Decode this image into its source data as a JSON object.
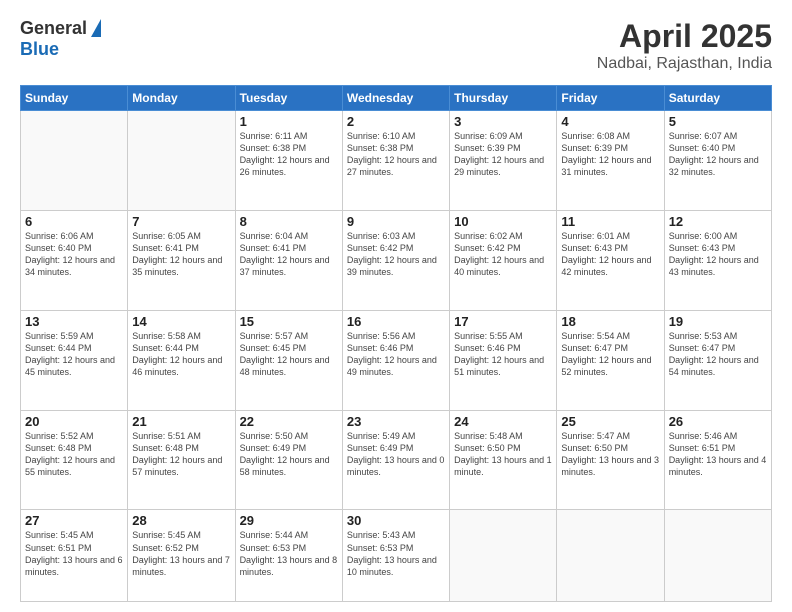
{
  "header": {
    "logo_general": "General",
    "logo_blue": "Blue",
    "title": "April 2025",
    "subtitle": "Nadbai, Rajasthan, India"
  },
  "days_of_week": [
    "Sunday",
    "Monday",
    "Tuesday",
    "Wednesday",
    "Thursday",
    "Friday",
    "Saturday"
  ],
  "weeks": [
    [
      {
        "day": "",
        "info": ""
      },
      {
        "day": "",
        "info": ""
      },
      {
        "day": "1",
        "info": "Sunrise: 6:11 AM\nSunset: 6:38 PM\nDaylight: 12 hours\nand 26 minutes."
      },
      {
        "day": "2",
        "info": "Sunrise: 6:10 AM\nSunset: 6:38 PM\nDaylight: 12 hours\nand 27 minutes."
      },
      {
        "day": "3",
        "info": "Sunrise: 6:09 AM\nSunset: 6:39 PM\nDaylight: 12 hours\nand 29 minutes."
      },
      {
        "day": "4",
        "info": "Sunrise: 6:08 AM\nSunset: 6:39 PM\nDaylight: 12 hours\nand 31 minutes."
      },
      {
        "day": "5",
        "info": "Sunrise: 6:07 AM\nSunset: 6:40 PM\nDaylight: 12 hours\nand 32 minutes."
      }
    ],
    [
      {
        "day": "6",
        "info": "Sunrise: 6:06 AM\nSunset: 6:40 PM\nDaylight: 12 hours\nand 34 minutes."
      },
      {
        "day": "7",
        "info": "Sunrise: 6:05 AM\nSunset: 6:41 PM\nDaylight: 12 hours\nand 35 minutes."
      },
      {
        "day": "8",
        "info": "Sunrise: 6:04 AM\nSunset: 6:41 PM\nDaylight: 12 hours\nand 37 minutes."
      },
      {
        "day": "9",
        "info": "Sunrise: 6:03 AM\nSunset: 6:42 PM\nDaylight: 12 hours\nand 39 minutes."
      },
      {
        "day": "10",
        "info": "Sunrise: 6:02 AM\nSunset: 6:42 PM\nDaylight: 12 hours\nand 40 minutes."
      },
      {
        "day": "11",
        "info": "Sunrise: 6:01 AM\nSunset: 6:43 PM\nDaylight: 12 hours\nand 42 minutes."
      },
      {
        "day": "12",
        "info": "Sunrise: 6:00 AM\nSunset: 6:43 PM\nDaylight: 12 hours\nand 43 minutes."
      }
    ],
    [
      {
        "day": "13",
        "info": "Sunrise: 5:59 AM\nSunset: 6:44 PM\nDaylight: 12 hours\nand 45 minutes."
      },
      {
        "day": "14",
        "info": "Sunrise: 5:58 AM\nSunset: 6:44 PM\nDaylight: 12 hours\nand 46 minutes."
      },
      {
        "day": "15",
        "info": "Sunrise: 5:57 AM\nSunset: 6:45 PM\nDaylight: 12 hours\nand 48 minutes."
      },
      {
        "day": "16",
        "info": "Sunrise: 5:56 AM\nSunset: 6:46 PM\nDaylight: 12 hours\nand 49 minutes."
      },
      {
        "day": "17",
        "info": "Sunrise: 5:55 AM\nSunset: 6:46 PM\nDaylight: 12 hours\nand 51 minutes."
      },
      {
        "day": "18",
        "info": "Sunrise: 5:54 AM\nSunset: 6:47 PM\nDaylight: 12 hours\nand 52 minutes."
      },
      {
        "day": "19",
        "info": "Sunrise: 5:53 AM\nSunset: 6:47 PM\nDaylight: 12 hours\nand 54 minutes."
      }
    ],
    [
      {
        "day": "20",
        "info": "Sunrise: 5:52 AM\nSunset: 6:48 PM\nDaylight: 12 hours\nand 55 minutes."
      },
      {
        "day": "21",
        "info": "Sunrise: 5:51 AM\nSunset: 6:48 PM\nDaylight: 12 hours\nand 57 minutes."
      },
      {
        "day": "22",
        "info": "Sunrise: 5:50 AM\nSunset: 6:49 PM\nDaylight: 12 hours\nand 58 minutes."
      },
      {
        "day": "23",
        "info": "Sunrise: 5:49 AM\nSunset: 6:49 PM\nDaylight: 13 hours\nand 0 minutes."
      },
      {
        "day": "24",
        "info": "Sunrise: 5:48 AM\nSunset: 6:50 PM\nDaylight: 13 hours\nand 1 minute."
      },
      {
        "day": "25",
        "info": "Sunrise: 5:47 AM\nSunset: 6:50 PM\nDaylight: 13 hours\nand 3 minutes."
      },
      {
        "day": "26",
        "info": "Sunrise: 5:46 AM\nSunset: 6:51 PM\nDaylight: 13 hours\nand 4 minutes."
      }
    ],
    [
      {
        "day": "27",
        "info": "Sunrise: 5:45 AM\nSunset: 6:51 PM\nDaylight: 13 hours\nand 6 minutes."
      },
      {
        "day": "28",
        "info": "Sunrise: 5:45 AM\nSunset: 6:52 PM\nDaylight: 13 hours\nand 7 minutes."
      },
      {
        "day": "29",
        "info": "Sunrise: 5:44 AM\nSunset: 6:53 PM\nDaylight: 13 hours\nand 8 minutes."
      },
      {
        "day": "30",
        "info": "Sunrise: 5:43 AM\nSunset: 6:53 PM\nDaylight: 13 hours\nand 10 minutes."
      },
      {
        "day": "",
        "info": ""
      },
      {
        "day": "",
        "info": ""
      },
      {
        "day": "",
        "info": ""
      }
    ]
  ]
}
